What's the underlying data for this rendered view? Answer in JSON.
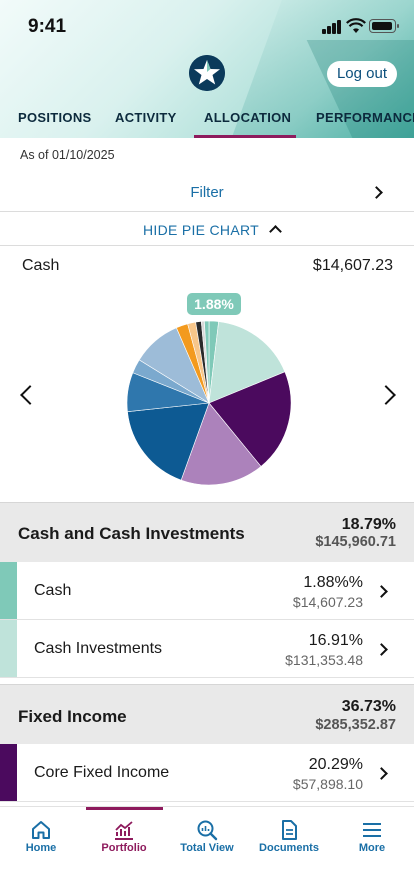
{
  "status_bar": {
    "time": "9:41"
  },
  "header": {
    "logout_label": "Log out"
  },
  "tabs": [
    {
      "label": "POSITIONS"
    },
    {
      "label": "ACTIVITY"
    },
    {
      "label": "ALLOCATION",
      "active": true
    },
    {
      "label": "PERFORMANCE"
    }
  ],
  "as_of": "As of 01/10/2025",
  "filter_label": "Filter",
  "hide_chart_label": "HIDE PIE CHART",
  "selected": {
    "name": "Cash",
    "value": "$14,607.23",
    "callout": "1.88%"
  },
  "chart_data": {
    "type": "pie",
    "slices": [
      {
        "value": 1.88,
        "color": "#7fc9b8"
      },
      {
        "value": 16.91,
        "color": "#bfe3da"
      },
      {
        "value": 20.29,
        "color": "#4b0a5e"
      },
      {
        "value": 16.44,
        "color": "#ac82bb"
      },
      {
        "value": 17.8,
        "color": "#0d5a93"
      },
      {
        "value": 7.7,
        "color": "#2f77ad"
      },
      {
        "value": 2.8,
        "color": "#7ba9ce"
      },
      {
        "value": 9.68,
        "color": "#9dbcd8"
      },
      {
        "value": 2.3,
        "color": "#f39a1e"
      },
      {
        "value": 1.6,
        "color": "#f7c68a"
      },
      {
        "value": 1.1,
        "color": "#2a2a2a"
      },
      {
        "value": 0.6,
        "color": "#d9d9d9"
      },
      {
        "value": 0.9,
        "color": "#7fc9b8"
      }
    ]
  },
  "groups": [
    {
      "name": "Cash and Cash Investments",
      "pct": "18.79%",
      "amount": "$145,960.71",
      "items": [
        {
          "name": "Cash",
          "pct": "1.88%%",
          "amount": "$14,607.23",
          "color": "#7fc9b8"
        },
        {
          "name": "Cash Investments",
          "pct": "16.91%",
          "amount": "$131,353.48",
          "color": "#bfe3da"
        }
      ]
    },
    {
      "name": "Fixed Income",
      "pct": "36.73%",
      "amount": "$285,352.87",
      "items": [
        {
          "name": "Core Fixed Income",
          "pct": "20.29%",
          "amount": "$57,898.10",
          "color": "#4b0a5e"
        }
      ]
    }
  ],
  "bottom_nav": [
    {
      "label": "Home",
      "icon": "home-icon"
    },
    {
      "label": "Portfolio",
      "icon": "portfolio-chart-icon",
      "active": true
    },
    {
      "label": "Total View",
      "icon": "total-view-icon"
    },
    {
      "label": "Documents",
      "icon": "documents-icon"
    },
    {
      "label": "More",
      "icon": "menu-icon"
    }
  ]
}
